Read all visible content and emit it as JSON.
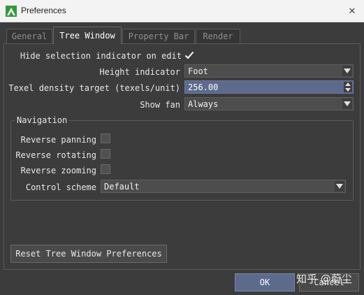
{
  "window": {
    "title": "Preferences"
  },
  "tabs": [
    {
      "label": "General",
      "active": false
    },
    {
      "label": "Tree Window",
      "active": true
    },
    {
      "label": "Property Bar",
      "active": false
    },
    {
      "label": "Render",
      "active": false
    }
  ],
  "settings": {
    "hide_selection": {
      "label": "Hide selection indicator on edit",
      "checked": true
    },
    "height_indicator": {
      "label": "Height indicator",
      "value": "Foot"
    },
    "texel_density": {
      "label": "Texel density target (texels/unit)",
      "value": "256.00"
    },
    "show_fan": {
      "label": "Show fan",
      "value": "Always"
    }
  },
  "navigation": {
    "title": "Navigation",
    "reverse_panning": {
      "label": "Reverse panning",
      "checked": false
    },
    "reverse_rotating": {
      "label": "Reverse rotating",
      "checked": false
    },
    "reverse_zooming": {
      "label": "Reverse zooming",
      "checked": false
    },
    "control_scheme": {
      "label": "Control scheme",
      "value": "Default"
    }
  },
  "buttons": {
    "reset": "Reset Tree Window Preferences",
    "ok": "OK",
    "cancel": "Cancel"
  },
  "watermark": "知乎 @蔚尘",
  "colors": {
    "accent": "#5c6a8c",
    "background": "#3c3c3c",
    "titlebar": "#f3f3f3"
  }
}
